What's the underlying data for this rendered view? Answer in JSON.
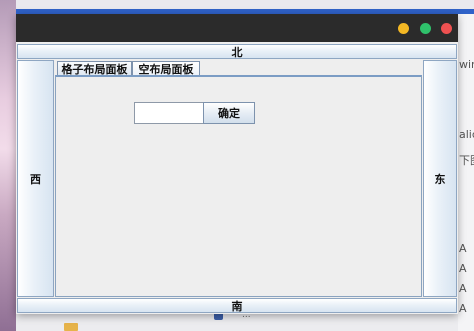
{
  "window": {
    "controls": [
      {
        "name": "minimize",
        "color": "#f4b824"
      },
      {
        "name": "maximize",
        "color": "#2fc16b"
      },
      {
        "name": "close",
        "color": "#ee5151"
      }
    ]
  },
  "border_layout": {
    "north": "北",
    "south": "南",
    "west": "西",
    "east": "东"
  },
  "tabs": [
    {
      "label": "格子布局面板",
      "selected": false
    },
    {
      "label": "空布局面板",
      "selected": true
    }
  ],
  "panel": {
    "text_field_value": "",
    "confirm_label": "确定"
  },
  "background_fragments": {
    "right_texts": [
      "win",
      "alic",
      "下图",
      "A",
      "A",
      "A",
      "A"
    ],
    "bottom_row_text": "..."
  }
}
